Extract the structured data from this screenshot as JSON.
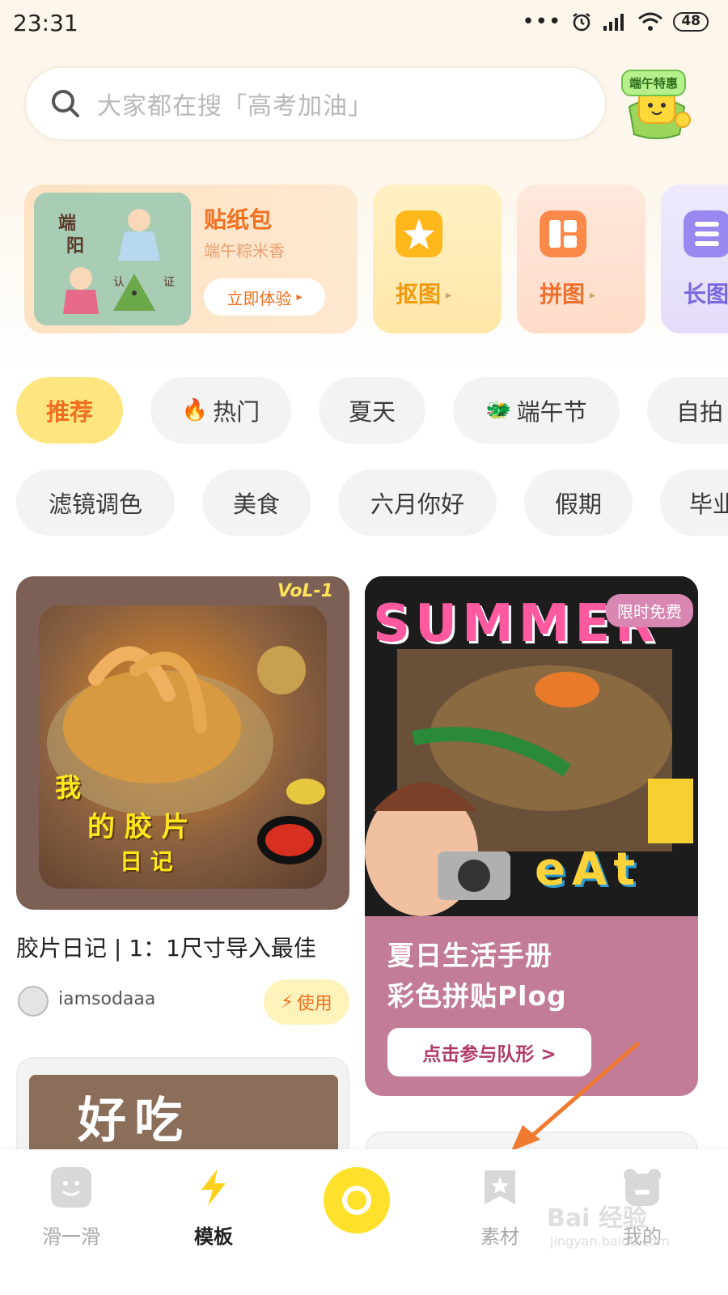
{
  "status_bar": {
    "time": "23:31",
    "dots": "•••",
    "battery": "48"
  },
  "search": {
    "placeholder": "大家都在搜「高考加油」"
  },
  "promo": {
    "tag": "端午特惠"
  },
  "feature_cards": {
    "sticker": {
      "title": "贴纸包",
      "subtitle": "端午粽米香",
      "button": "立即体验",
      "stickers": [
        "端",
        "阳",
        "认",
        "证"
      ]
    },
    "cutout": {
      "label": "抠图"
    },
    "collage": {
      "label": "拼图"
    },
    "long_image": {
      "label": "长图"
    }
  },
  "chips_row1": [
    {
      "label": "推荐",
      "icon": ""
    },
    {
      "label": "热门",
      "icon": "🔥"
    },
    {
      "label": "夏天",
      "icon": ""
    },
    {
      "label": "端午节",
      "icon": "🐲"
    },
    {
      "label": "自拍",
      "icon": ""
    }
  ],
  "chips_row2": [
    {
      "label": "滤镜调色"
    },
    {
      "label": "美食"
    },
    {
      "label": "六月你好"
    },
    {
      "label": "假期"
    },
    {
      "label": "毕业"
    }
  ],
  "feed": {
    "film_diary": {
      "volume": "VoL-1",
      "overlay_lines": [
        "我",
        "的 胶 片",
        "日 记"
      ],
      "title": "胶片日记 | 1：1尺寸导入最佳",
      "author": "iamsodaaa",
      "use_button": "使用"
    },
    "summer": {
      "badge": "限时免费",
      "overlay_word": "SUMMER",
      "overlay_word2": "eAt",
      "title_line1": "夏日生活手册",
      "title_line2": "彩色拼贴Plog",
      "button": "点击参与队形 >"
    },
    "card3": {
      "overlay_text": "好吃"
    }
  },
  "bottom_nav": [
    {
      "label": "滑一滑"
    },
    {
      "label": "模板"
    },
    {
      "label": "素材"
    },
    {
      "label": "我的"
    }
  ],
  "watermark": {
    "text": "Bai 经验",
    "sub": "jingyan.baidu.com"
  },
  "colors": {
    "accent": "#f07020",
    "active_chip_bg": "#ffe580",
    "camera": "#ffe12c",
    "summer_card": "#c27c98"
  }
}
